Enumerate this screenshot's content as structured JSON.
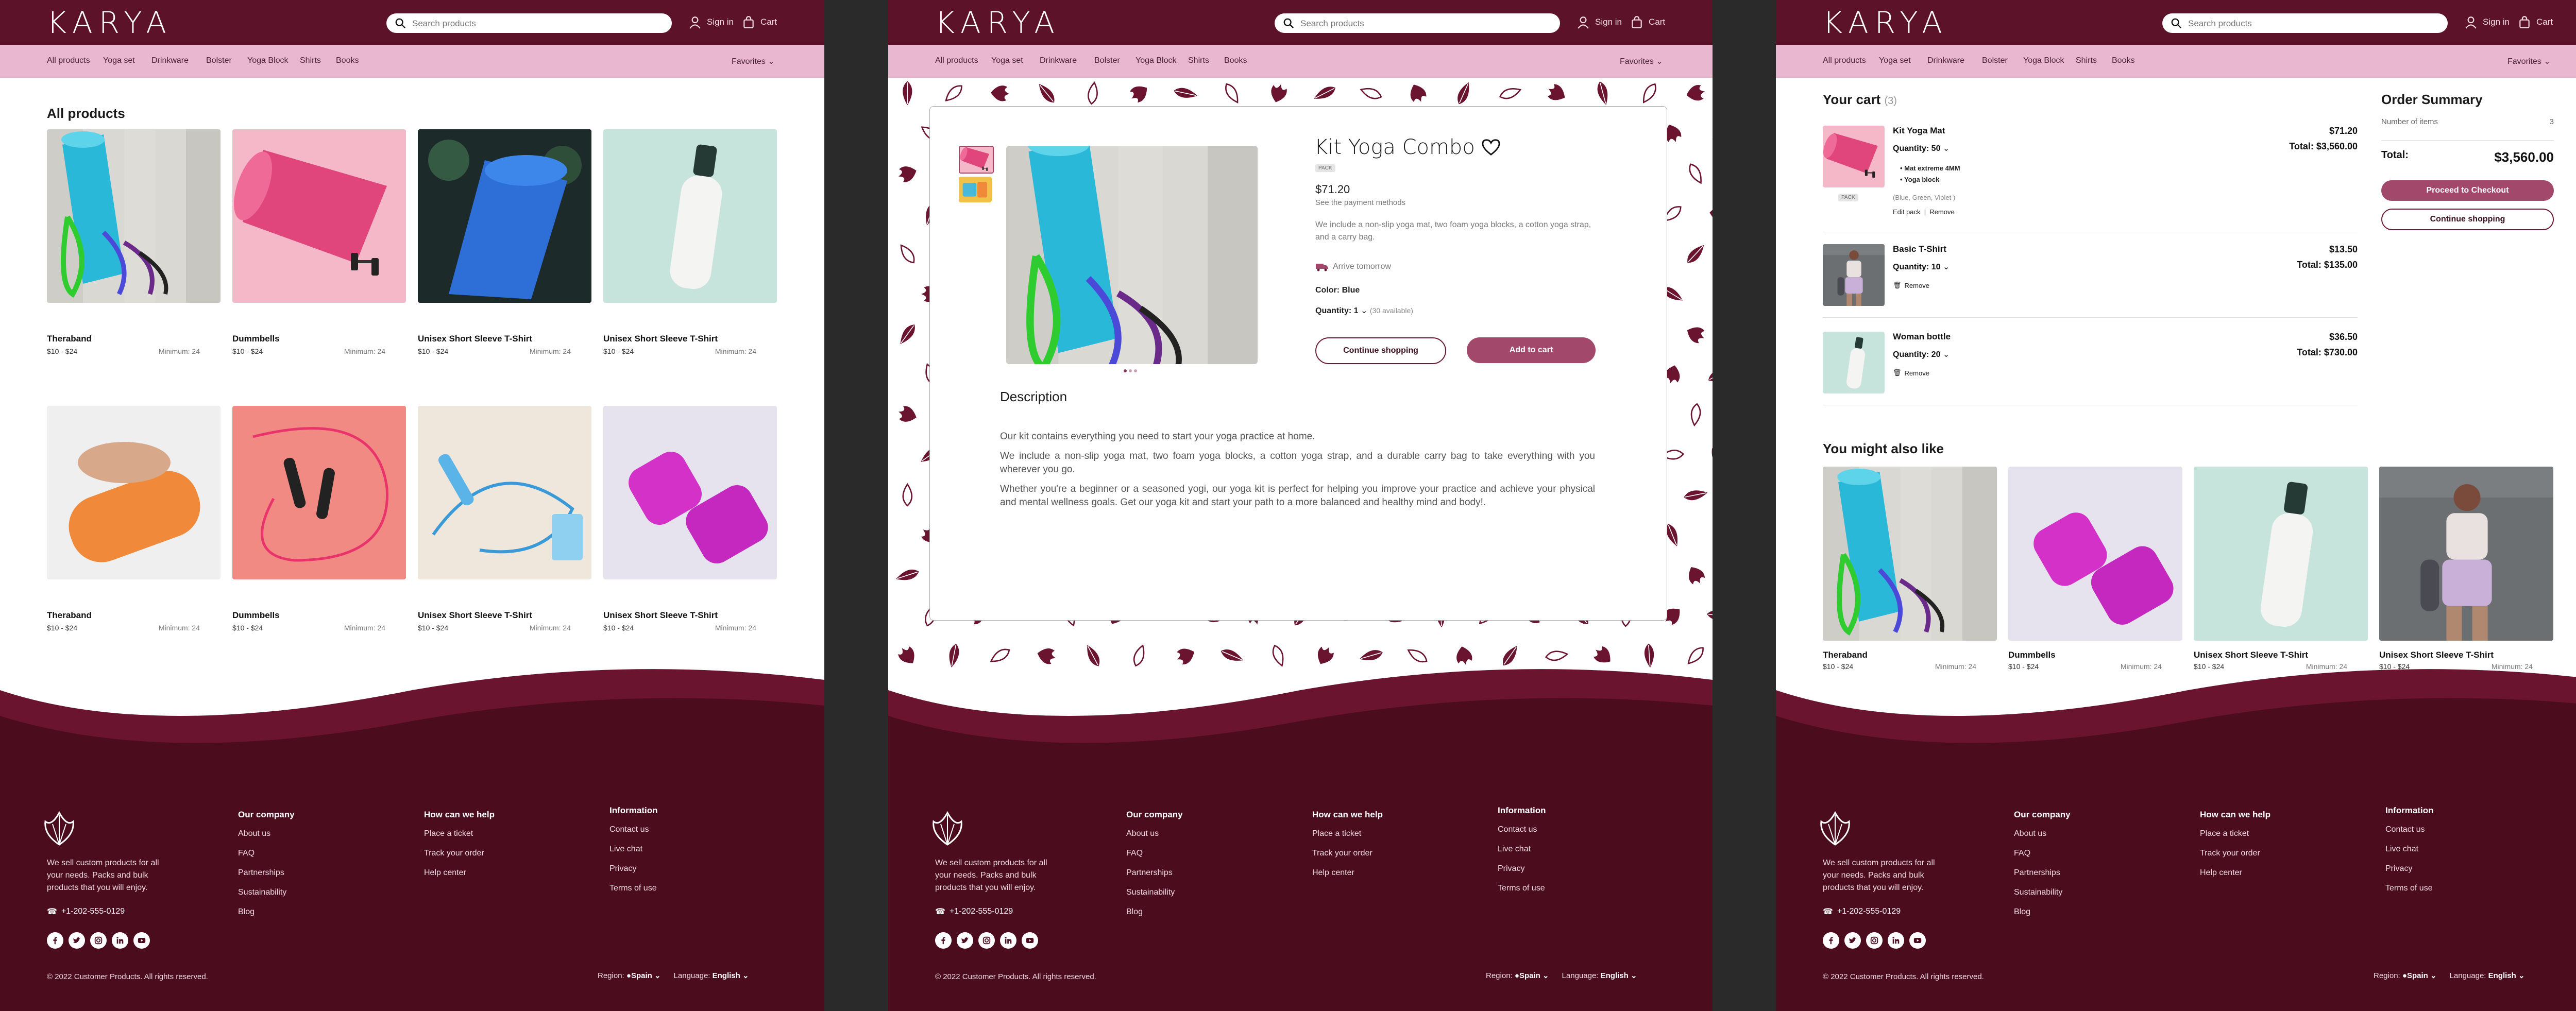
{
  "header": {
    "logo": "KARYA",
    "search_placeholder": "Search products",
    "sign_in": "Sign in",
    "cart": "Cart"
  },
  "nav": {
    "items": [
      "All products",
      "Yoga set",
      "Drinkware",
      "Bolster",
      "Yoga Block",
      "Shirts",
      "Books"
    ],
    "favorites": "Favorites"
  },
  "catalog": {
    "title": "All products",
    "products": [
      {
        "name": "Theraband",
        "price": "$10 - $24",
        "minimum": "Minimum: 24"
      },
      {
        "name": "Dummbells",
        "price": "$10 - $24",
        "minimum": "Minimum: 24"
      },
      {
        "name": "Unisex Short Sleeve T-Shirt",
        "price": "$10 - $24",
        "minimum": "Minimum: 24"
      },
      {
        "name": "Unisex Short Sleeve T-Shirt",
        "price": "$10 - $24",
        "minimum": "Minimum: 24"
      },
      {
        "name": "Theraband",
        "price": "$10 - $24",
        "minimum": "Minimum: 24"
      },
      {
        "name": "Dummbells",
        "price": "$10 - $24",
        "minimum": "Minimum: 24"
      },
      {
        "name": "Unisex Short Sleeve T-Shirt",
        "price": "$10 - $24",
        "minimum": "Minimum: 24"
      },
      {
        "name": "Unisex Short Sleeve T-Shirt",
        "price": "$10 - $24",
        "minimum": "Minimum: 24"
      }
    ]
  },
  "product": {
    "title": "Kit Yoga Combo",
    "badge": "PACK",
    "price": "$71.20",
    "payment_link": "See the payment methods",
    "short_desc": "We include a non-slip yoga mat, two foam yoga blocks, a cotton yoga strap, and a carry bag.",
    "shipping": "Arrive tomorrow",
    "color_label": "Color:",
    "color_value": "Blue",
    "quantity_label": "Quantity:",
    "quantity_value": "1",
    "available": "(30 available)",
    "continue_btn": "Continue shopping",
    "add_btn": "Add to cart",
    "description_title": "Description",
    "description": [
      "Our kit contains everything you need to start your yoga practice at home.",
      "We include a non-slip yoga mat, two foam yoga blocks, a cotton yoga strap, and a durable carry bag to take everything with you wherever you go.",
      "Whether you're a beginner or a seasoned yogi, our yoga kit is perfect for helping you improve your practice and achieve your physical and mental wellness goals. Get our yoga kit and start your path to a more balanced and healthy mind and body!."
    ]
  },
  "cart": {
    "title": "Your cart",
    "count": "(3)",
    "items": [
      {
        "name": "Kit Yoga Mat",
        "quantity_label": "Quantity:",
        "quantity": "50",
        "unit_price": "$71.20",
        "total": "Total: $3,560.00",
        "bullets": [
          "Mat extreme 4MM",
          "Yoga block"
        ],
        "badge": "PACK",
        "variant": "(Blue, Green, Violet )",
        "edit": "Edit pack",
        "remove": "Remove"
      },
      {
        "name": "Basic T-Shirt",
        "quantity_label": "Quantity:",
        "quantity": "10",
        "unit_price": "$13.50",
        "total": "Total: $135.00",
        "remove": "Remove"
      },
      {
        "name": "Woman bottle",
        "quantity_label": "Quantity:",
        "quantity": "20",
        "unit_price": "$36.50",
        "total": "Total: $730.00",
        "remove": "Remove"
      }
    ]
  },
  "summary": {
    "title": "Order Summary",
    "items_label": "Number of items",
    "items_value": "3",
    "total_label": "Total:",
    "total_value": "$3,560.00",
    "checkout_btn": "Proceed to Checkout",
    "continue_btn": "Continue shopping"
  },
  "recommend": {
    "title": "You might also like",
    "products": [
      {
        "name": "Theraband",
        "price": "$10 - $24",
        "minimum": "Minimum: 24"
      },
      {
        "name": "Dummbells",
        "price": "$10 - $24",
        "minimum": "Minimum: 24"
      },
      {
        "name": "Unisex Short Sleeve T-Shirt",
        "price": "$10 - $24",
        "minimum": "Minimum: 24"
      },
      {
        "name": "Unisex Short Sleeve T-Shirt",
        "price": "$10 - $24",
        "minimum": "Minimum: 24"
      }
    ]
  },
  "footer": {
    "description": "We sell custom products for all your needs. Packs and bulk products that you will enjoy.",
    "phone": "+1-202-555-0129",
    "col1_title": "Our company",
    "col1": [
      "About us",
      "FAQ",
      "Partnerships",
      "Sustainability",
      "Blog"
    ],
    "col2_title": "How can we help",
    "col2": [
      "Place a ticket",
      "Track your order",
      "Help center"
    ],
    "col3_title": "Information",
    "col3": [
      "Contact us",
      "Live chat",
      "Privacy",
      "Terms of use"
    ],
    "copyright": "© 2022 Customer Products. All rights reserved.",
    "region_label": "Region:",
    "region_value": "Spain",
    "language_label": "Language:",
    "language_value": "English"
  },
  "colors": {
    "header": "#5c1228",
    "nav": "#e9b8d0",
    "footer": "#4b0c1e",
    "accent": "#a2486a"
  }
}
